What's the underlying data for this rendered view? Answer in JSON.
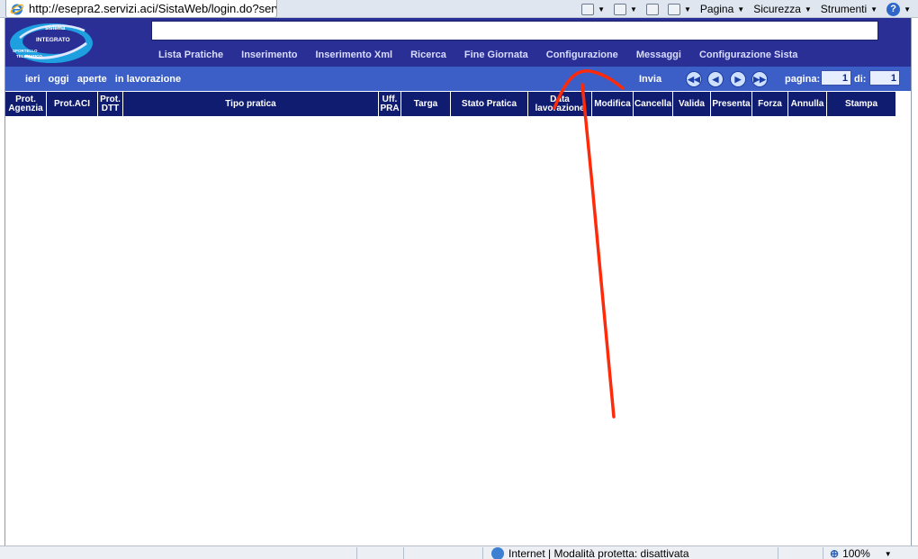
{
  "browser": {
    "tab_title": "http://esepra2.servizi.aci/SistaWeb/login.do?servi...",
    "menu": {
      "pagina": "Pagina",
      "sicurezza": "Sicurezza",
      "strumenti": "Strumenti"
    },
    "status": {
      "zone": "Internet | Modalità protetta: disattivata",
      "zoom": "100%"
    }
  },
  "header": {
    "logo_text": [
      "sistema",
      "INTEGRATO",
      "SPORTELLO",
      "TELEMATICO"
    ],
    "nav": [
      "Lista Pratiche",
      "Inserimento",
      "Inserimento Xml",
      "Ricerca",
      "Fine Giornata",
      "Configurazione",
      "Messaggi",
      "Configurazione Sista"
    ]
  },
  "toolbar": {
    "filters": [
      "ieri",
      "oggi",
      "aperte",
      "in lavorazione"
    ],
    "invia": "Invia",
    "pagina_label": "pagina:",
    "pagina_value": "1",
    "di_label": "di:",
    "di_value": "1"
  },
  "table": {
    "columns": [
      {
        "lines": [
          "Prot.",
          "Agenzia"
        ]
      },
      {
        "lines": [
          "Prot.ACI"
        ]
      },
      {
        "lines": [
          "Prot.",
          "DTT"
        ]
      },
      {
        "lines": [
          "Tipo pratica"
        ]
      },
      {
        "lines": [
          "Uff.",
          "PRA"
        ]
      },
      {
        "lines": [
          "Targa"
        ]
      },
      {
        "lines": [
          "Stato Pratica"
        ]
      },
      {
        "lines": [
          "Data",
          "lavorazione"
        ]
      },
      {
        "lines": [
          "Modifica"
        ]
      },
      {
        "lines": [
          "Cancella"
        ]
      },
      {
        "lines": [
          "Valida"
        ]
      },
      {
        "lines": [
          "Presenta"
        ]
      },
      {
        "lines": [
          "Forza"
        ]
      },
      {
        "lines": [
          "Annulla"
        ]
      },
      {
        "lines": [
          "Stampa"
        ]
      }
    ],
    "rows": []
  },
  "colors": {
    "header_bg": "#2a2f96",
    "toolbar_bg": "#3b5fc7",
    "table_header_bg": "#0f1c70",
    "annotation_red": "#ff2a0a"
  }
}
